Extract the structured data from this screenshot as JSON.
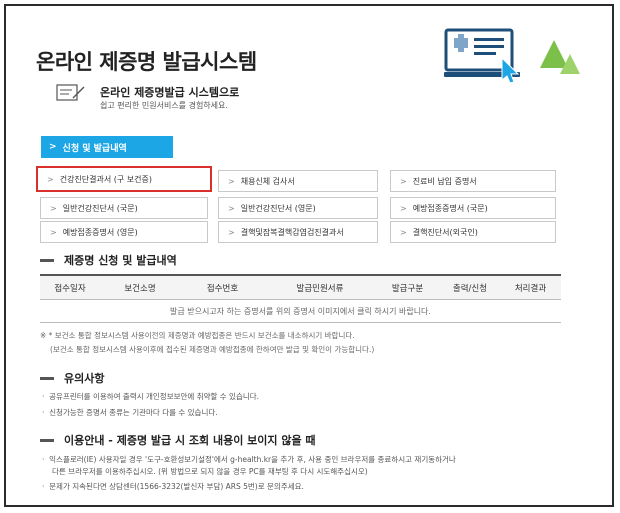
{
  "header": {
    "title": "온라인 제증명 발급시스템",
    "sub_title": "온라인 제증명발급 시스템으로",
    "sub_desc": "쉽고 편리한 민원서비스를 경험하세요."
  },
  "colors": {
    "accent_blue": "#1ca6e6",
    "highlight_red": "#d9302b",
    "tree_green": "#7cc04a"
  },
  "apply_button": {
    "arrow": ">",
    "label": "신청 및 발급내역"
  },
  "certificates": [
    {
      "arrow": ">",
      "label": "건강진단결과서 (구 보건증)"
    },
    {
      "arrow": ">",
      "label": "채용신체 검사서"
    },
    {
      "arrow": ">",
      "label": "진료비 납입 증명서"
    },
    {
      "arrow": ">",
      "label": "일반건강진단서 (국문)"
    },
    {
      "arrow": ">",
      "label": "일반건강진단서 (영문)"
    },
    {
      "arrow": ">",
      "label": "예방접종증명서 (국문)"
    },
    {
      "arrow": ">",
      "label": "예방접종증명서 (영문)"
    },
    {
      "arrow": ">",
      "label": "결핵및잠복결핵감염검진결과서"
    },
    {
      "arrow": ">",
      "label": "결핵진단서(외국인)"
    }
  ],
  "section1": {
    "title": "제증명 신청 및 발급내역",
    "columns": [
      "접수일자",
      "보건소명",
      "접수번호",
      "발급민원서류",
      "발급구분",
      "출력/신청",
      "처리결과"
    ],
    "empty_message": "발급 받으시고자 하는 증명서를 위의 증명서 이미지에서 클릭 하시기 바랍니다."
  },
  "notes": {
    "line1": "※ * 보건소 통합 정보시스템 사용이전의 제증명과 예방접종은 반드시 보건소를 내소하시기 바랍니다.",
    "line2": "(보건소 통합 정보시스템 사용이후에 접수된 제증명과 예방접종에 한하여만 발급 및 확인이 가능합니다.)"
  },
  "section2": {
    "title": "유의사항",
    "items": [
      "공유프린터를 이용하여 출력시 개인정보보안에 취약할 수 있습니다.",
      "신청가능한 증명서 종류는 기관마다 다를 수 있습니다."
    ]
  },
  "section3": {
    "title": "이용안내 - 제증명 발급 시 조회 내용이 보이지 않을 때",
    "item1_line1": "익스플로러(IE) 사용자일 경우 '도구-호환성보기설정'에서 g-health.kr을 추가 후, 사용 중인 브라우저를 종료하시고 재기동하거나",
    "item1_line2": "다른 브라우저를 이용하주십시오. (위 방법으로 되지 않을 경우 PC를 재부팅 후 다시 시도해주십시오)",
    "item2": "문제가 지속된다면 상담센터(1566-3232(발신자 부담) ARS 5번)로 문의주세요."
  }
}
